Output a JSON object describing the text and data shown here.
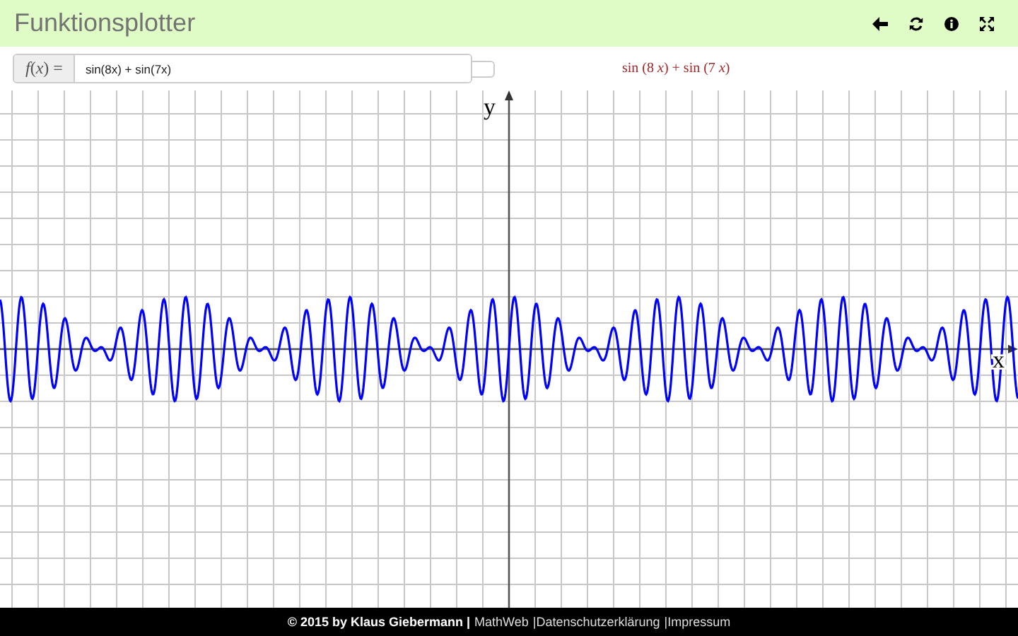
{
  "header": {
    "title": "Funktionsplotter",
    "tools": [
      {
        "kind": "back"
      },
      {
        "kind": "refresh"
      },
      {
        "kind": "info"
      },
      {
        "kind": "fullscreen"
      }
    ]
  },
  "input": {
    "label": "*f*(*x*) =",
    "value": "sin(8x) + sin(7x)"
  },
  "formula": "sin (8 *x*) + sin (7 *x*)",
  "plot": {
    "x_label": "x",
    "y_label": "y"
  },
  "footer": [
    {
      "kind": "text",
      "text": "© 2015 by Klaus Giebermann |"
    },
    {
      "kind": "link",
      "text": "MathWeb"
    },
    {
      "kind": "sep",
      "text": "|"
    },
    {
      "kind": "link",
      "text": "Datenschutzerklärung"
    },
    {
      "kind": "sep",
      "text": "|"
    },
    {
      "kind": "link",
      "text": "Impressum"
    }
  ]
}
